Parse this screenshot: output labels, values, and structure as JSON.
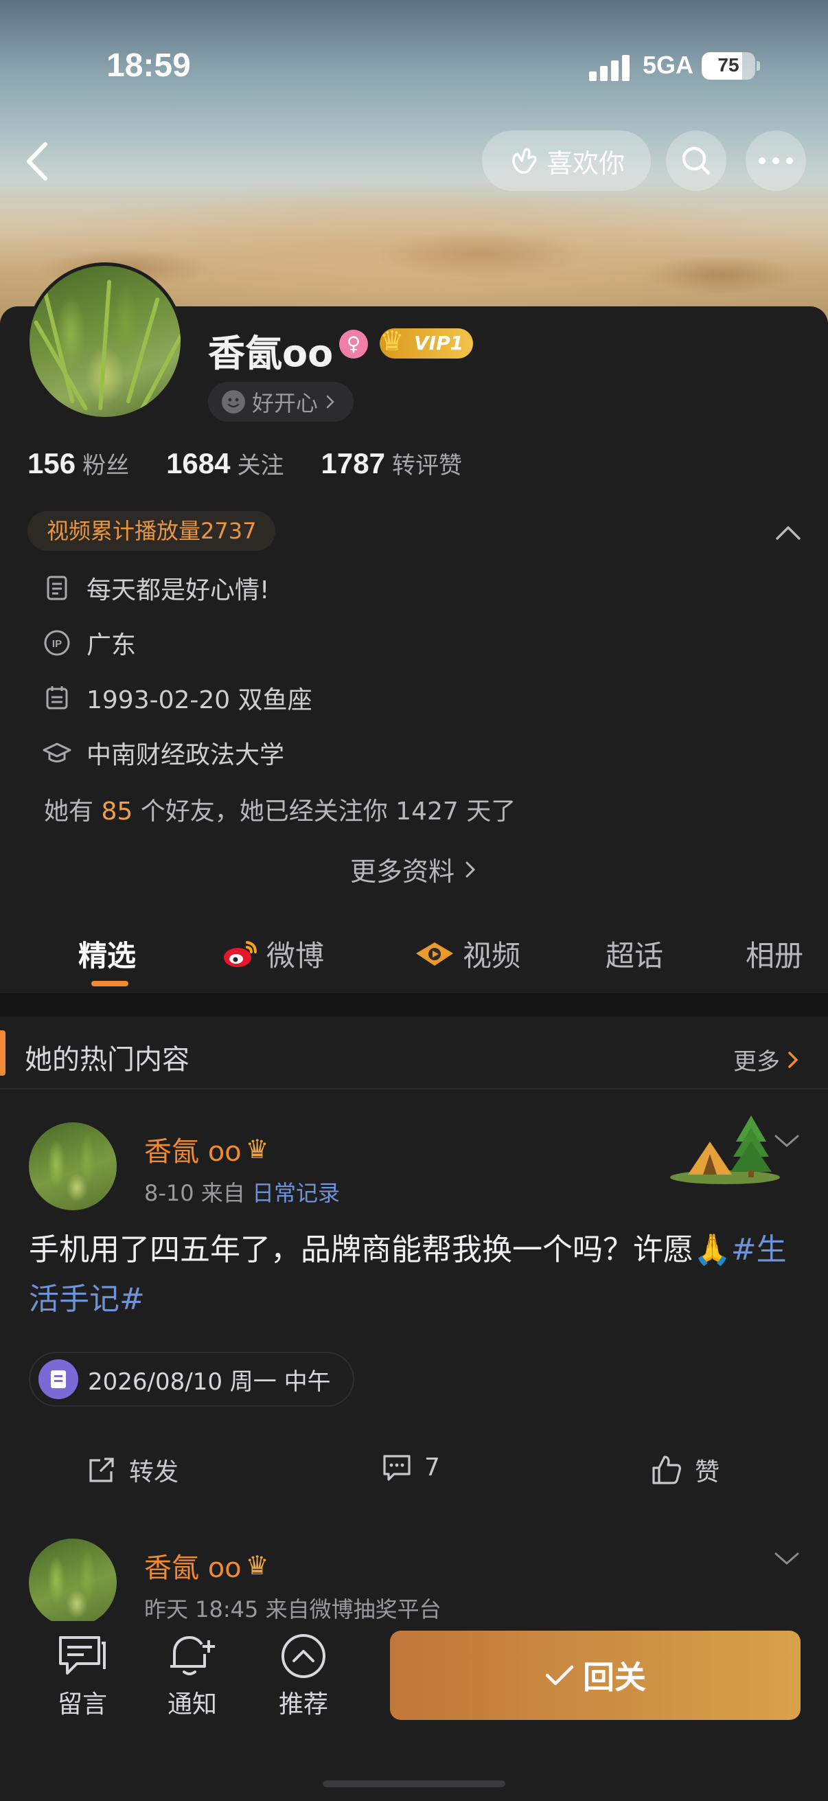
{
  "status_bar": {
    "time": "18:59",
    "network": "5GA",
    "battery": "75",
    "battery_level": 0.75
  },
  "header": {
    "like_label": "喜欢你"
  },
  "profile": {
    "name": "香氤oo",
    "vip": "VIP1",
    "mood": "好开心",
    "stats": [
      {
        "value": "156",
        "label": "粉丝"
      },
      {
        "value": "1684",
        "label": "关注"
      },
      {
        "value": "1787",
        "label": "转评赞"
      }
    ],
    "video_plays": "视频累计播放量2737",
    "bio": "每天都是好心情!",
    "ip_location": "广东",
    "birthday": "1993-02-20 双鱼座",
    "school": "中南财经政法大学",
    "friends_prefix": "她有",
    "friends_count": "85",
    "friends_suffix": "个好友，她已经关注你 1427 天了",
    "more_info": "更多资料"
  },
  "tabs": [
    "精选",
    "微博",
    "视频",
    "超话",
    "相册"
  ],
  "hot_section": {
    "title": "她的热门内容",
    "more": "更多"
  },
  "posts": [
    {
      "author": "香氤 oo",
      "meta_prefix": "8-10  来自",
      "source": "日常记录",
      "text": "手机用了四五年了，品牌商能帮我换一个吗？许愿🙏",
      "tag": "#生活手记#",
      "date_card": "2026/08/10 周一 中午",
      "actions": {
        "repost": "转发",
        "comments": "7",
        "like": "赞"
      }
    },
    {
      "author": "香氤 oo",
      "meta": "昨天 18:45  来自微博抽奖平台"
    }
  ],
  "bottom_bar": {
    "items": [
      "留言",
      "通知",
      "推荐"
    ],
    "follow_back": "回关"
  },
  "colors": {
    "accent": "#f08a33",
    "link": "#6f93d8",
    "background": "#1e1e1f"
  }
}
